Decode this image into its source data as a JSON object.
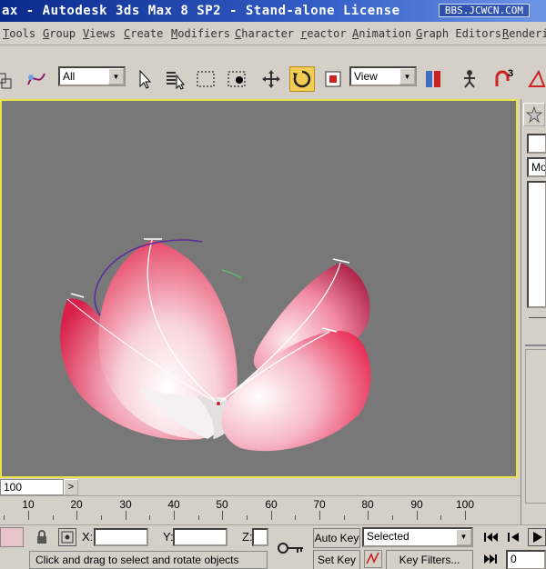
{
  "window": {
    "title": "ax - Autodesk 3ds Max 8 SP2  - Stand-alone License",
    "watermark": "BBS.JCWCN.COM"
  },
  "menu": [
    "Tools",
    "Group",
    "Views",
    "Create",
    "Modifiers",
    "Character",
    "reactor",
    "Animation",
    "Graph Editors",
    "Renderi"
  ],
  "toolbar": {
    "selection_filter": "All",
    "reference_coordinate": "View",
    "snap_label": "3"
  },
  "viewport": {
    "background": "#787878",
    "border_color": "#e8e44a"
  },
  "timeslider": {
    "frame_display": "100",
    "arrow": ">"
  },
  "trackbar": {
    "ticks": [
      "10",
      "20",
      "30",
      "40",
      "50",
      "60",
      "70",
      "80",
      "90",
      "100"
    ]
  },
  "status": {
    "x_label": "X:",
    "y_label": "Y:",
    "z_label": "Z:",
    "prompt": "Click and drag to select and rotate objects",
    "auto_key": "Auto Key",
    "set_key": "Set Key",
    "key_mode": "Selected",
    "key_filters": "Key Filters...",
    "current_frame": "0"
  },
  "panel": {
    "modifier_stub": "Mo"
  },
  "colors": {
    "accent": "#f2cc54",
    "petal": "#e32b4f",
    "petal_light": "#fbe6ec"
  }
}
